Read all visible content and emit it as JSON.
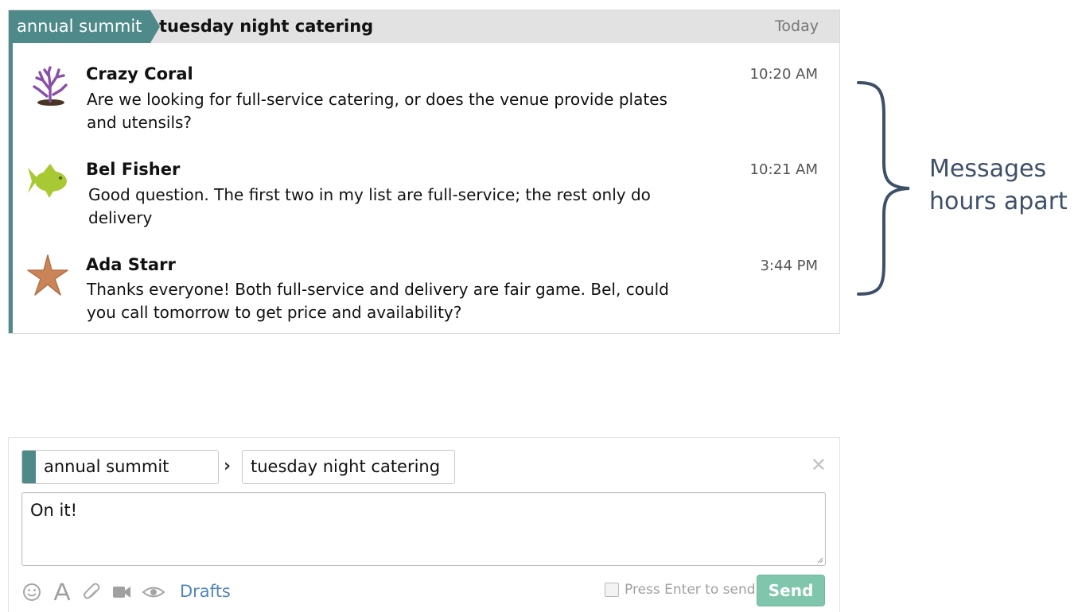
{
  "stream": {
    "name": "annual summit",
    "topic": "tuesday night catering",
    "date": "Today",
    "color": "#4f8a8b"
  },
  "messages": [
    {
      "sender": "Crazy Coral",
      "time": "10:20 AM",
      "avatar_icon": "coral-icon",
      "text_lines": [
        "Are we looking for full-service catering, or does the venue provide plates",
        "and utensils?"
      ]
    },
    {
      "sender": "Bel Fisher",
      "time": "10:21 AM",
      "avatar_icon": "fish-icon",
      "text_lines": [
        "Good question. The first two in my list are full-service; the rest only do",
        "delivery"
      ]
    },
    {
      "sender": "Ada Starr",
      "time": "3:44 PM",
      "avatar_icon": "starfish-icon",
      "text_lines": [
        "Thanks everyone! Both full-service and delivery are fair game. Bel, could",
        "you call tomorrow to get price and availability?"
      ]
    }
  ],
  "annotation": {
    "lines": [
      "Messages",
      "hours apart"
    ],
    "color": "#3e5068"
  },
  "compose": {
    "stream_value": "annual summit",
    "topic_value": "tuesday night catering",
    "message_value": "On it!",
    "toolbar_icons": [
      "smiley-icon",
      "format-text-icon",
      "paperclip-icon",
      "video-camera-icon",
      "eye-icon"
    ],
    "drafts_label": "Drafts",
    "press_enter_label": "Press Enter to send",
    "press_enter_checked": false,
    "send_label": "Send",
    "send_color": "#7fc6ac",
    "close_icon": "close-icon"
  }
}
